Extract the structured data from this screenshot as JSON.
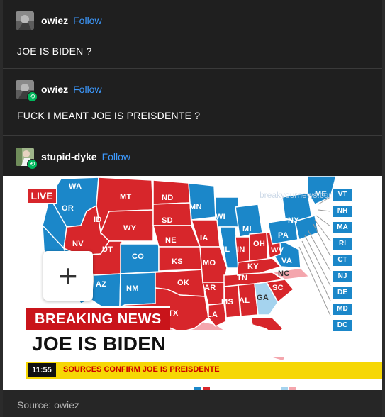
{
  "posts": [
    {
      "username": "owiez",
      "follow": "Follow",
      "text": "JOE IS BIDEN ?"
    },
    {
      "username": "owiez",
      "follow": "Follow",
      "text": "FUCK I MEANT JOE IS PREISDENTE ?"
    },
    {
      "username": "stupid-dyke",
      "follow": "Follow"
    }
  ],
  "media": {
    "live": "LIVE",
    "watermark": "breakyournews.com",
    "zoom": "+",
    "breaking": "BREAKING NEWS",
    "headline": "JOE IS BIDEN",
    "ticker_time": "11:55",
    "ticker_text": "SOURCES CONFIRM JOE IS PREISDENTE",
    "side_states": [
      "VT",
      "NH",
      "MA",
      "RI",
      "CT",
      "NJ",
      "DE",
      "MD",
      "DC"
    ],
    "map_labels": {
      "wa": "WA",
      "or": "OR",
      "id": "ID",
      "mt": "MT",
      "nd": "ND",
      "sd": "SD",
      "wy": "WY",
      "ne": "NE",
      "nv": "NV",
      "ut": "UT",
      "co": "CO",
      "ks": "KS",
      "az": "AZ",
      "nm": "NM",
      "ok": "OK",
      "tx": "TX",
      "mn": "MN",
      "wi": "WI",
      "ia": "IA",
      "mo": "MO",
      "il": "IL",
      "mi": "MI",
      "in": "IN",
      "oh": "OH",
      "ky": "KY",
      "tn": "TN",
      "ar": "AR",
      "ms": "MS",
      "al": "AL",
      "la": "LA",
      "ga": "GA",
      "sc": "SC",
      "nc": "NC",
      "va": "VA",
      "wv": "WV",
      "pa": "PA",
      "ny": "NY",
      "me": "ME"
    },
    "colors": {
      "red": "#d7262b",
      "blue": "#1b87c9",
      "pink": "#f4a6ad",
      "lightblue": "#a5d3ee"
    }
  },
  "source": "Source: owiez"
}
